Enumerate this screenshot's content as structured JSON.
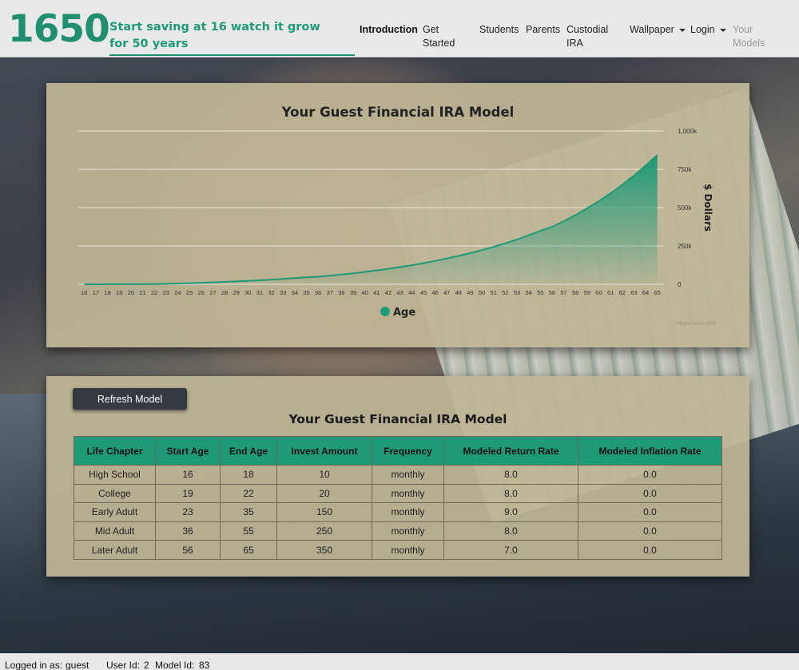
{
  "navbar": {
    "brand": "1650",
    "tagline": "Start saving at 16 watch it grow for 50 years",
    "links": {
      "introduction": "Introduction",
      "get_started_1": "Get",
      "get_started_2": "Started",
      "students": "Students",
      "parents": "Parents",
      "custodial_1": "Custodial",
      "custodial_2": "IRA",
      "wallpaper": "Wallpaper",
      "login": "Login",
      "your_models_1": "Your",
      "your_models_2": "Models"
    }
  },
  "chart": {
    "title": "Your Guest Financial IRA Model",
    "credits": "Highcharts.com",
    "series_color": "#1f9a76"
  },
  "chart_data": {
    "type": "area",
    "title": "Your Guest Financial IRA Model",
    "xlabel": "",
    "ylabel": "$ Dollars",
    "y_axis_side": "right",
    "ylim": [
      0,
      1000000
    ],
    "y_ticks": [
      0,
      250000,
      500000,
      750000,
      1000000
    ],
    "y_tick_labels": [
      "0",
      "250k",
      "500k",
      "750k",
      "1,000k"
    ],
    "grid": true,
    "legend_position": "bottom-center",
    "x": [
      16,
      17,
      18,
      19,
      20,
      21,
      22,
      23,
      24,
      25,
      26,
      27,
      28,
      29,
      30,
      31,
      32,
      33,
      34,
      35,
      36,
      37,
      38,
      39,
      40,
      41,
      42,
      43,
      44,
      45,
      46,
      47,
      48,
      49,
      50,
      51,
      52,
      53,
      54,
      55,
      56,
      57,
      58,
      59,
      60,
      61,
      62,
      63,
      64,
      65
    ],
    "series": [
      {
        "name": "Age",
        "values": [
          120,
          250,
          380,
          620,
          880,
          1140,
          1400,
          3250,
          5280,
          7500,
          9930,
          12600,
          15500,
          18700,
          22200,
          26100,
          30300,
          34900,
          40000,
          45500,
          48700,
          55800,
          63500,
          71800,
          80800,
          90500,
          101000,
          112400,
          124700,
          138000,
          152400,
          168000,
          184900,
          203200,
          222900,
          244300,
          267400,
          292400,
          319500,
          348800,
          374400,
          411600,
          451900,
          495500,
          542700,
          593800,
          649100,
          709000,
          773800,
          844000
        ]
      }
    ]
  },
  "table": {
    "refresh_label": "Refresh Model",
    "title": "Your Guest Financial IRA Model",
    "headers": [
      "Life Chapter",
      "Start Age",
      "End Age",
      "Invest Amount",
      "Frequency",
      "Modeled Return Rate",
      "Modeled Inflation Rate"
    ],
    "rows": [
      [
        "High School",
        "16",
        "18",
        "10",
        "monthly",
        "8.0",
        "0.0"
      ],
      [
        "College",
        "19",
        "22",
        "20",
        "monthly",
        "8.0",
        "0.0"
      ],
      [
        "Early Adult",
        "23",
        "35",
        "150",
        "monthly",
        "9.0",
        "0.0"
      ],
      [
        "Mid Adult",
        "36",
        "55",
        "250",
        "monthly",
        "8.0",
        "0.0"
      ],
      [
        "Later Adult",
        "56",
        "65",
        "350",
        "monthly",
        "7.0",
        "0.0"
      ]
    ]
  },
  "status": {
    "logged_in_label": "Logged in as:",
    "username": "guest",
    "user_id_label": "User Id:",
    "user_id": "2",
    "model_id_label": "Model Id:",
    "model_id": "83"
  }
}
